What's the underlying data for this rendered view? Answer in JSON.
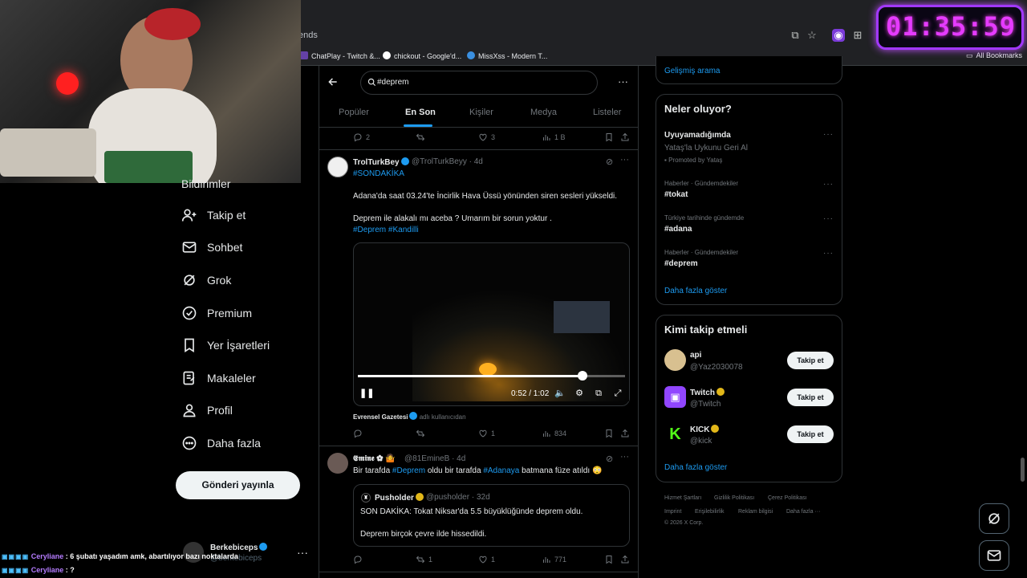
{
  "timer": "01:35:59",
  "browser": {
    "url_fragment": "ends",
    "bookmarks": [
      "ChatPlay - Twitch &...",
      "chickout - Google'd...",
      "MissXss - Modern T..."
    ],
    "all_bookmarks": "All Bookmarks"
  },
  "nav": {
    "items": [
      "Bildirimler",
      "Takip et",
      "Sohbet",
      "Grok",
      "Premium",
      "Yer İşaretleri",
      "Makaleler",
      "Profil",
      "Daha fazla"
    ],
    "post_button": "Gönderi yayınla",
    "profile_name": "Berkebiceps",
    "profile_handle": "@berkebiceps"
  },
  "chat": [
    {
      "user": "Ceryliane",
      "message": "6 şubatı yaşadım amk, abartılıyor bazı noktalarda"
    },
    {
      "user": "Ceryliane",
      "message": "?"
    }
  ],
  "search": {
    "query": "#deprem"
  },
  "tabs": [
    "Popüler",
    "En Son",
    "Kişiler",
    "Medya",
    "Listeler"
  ],
  "tweet0_actions": {
    "replies": "2",
    "retweets": "",
    "likes": "3",
    "views": "1 B"
  },
  "tweet1": {
    "name": "TrolTurkBey",
    "handle": "@TrolTurkBeyy · 4d",
    "hashtag_line": "#SONDAKİKA",
    "text1": "Adana'da saat 03.24'te İncirlik Hava Üssü yönünden siren sesleri yükseldi.",
    "text2": "Deprem ile alakalı mı aceba ? Umarım bir sorun yoktur .",
    "tags": "#Deprem #Kandilli",
    "video_time": "0:52 / 1:02",
    "video_progress": 0.84,
    "source_name": "Evrensel Gazetesi",
    "source_suffix": "adlı kullanıcıdan",
    "actions": {
      "replies": "",
      "retweets": "",
      "likes": "1",
      "views": "834"
    }
  },
  "tweet2": {
    "name": "𝕰𝖒𝖎𝖓𝖊 ✿ 🤷",
    "handle": "@81EmineB · 4d",
    "text_pre": "Bir tarafda ",
    "tag1": "#Deprem",
    "text_mid": " oldu bir tarafda ",
    "tag2": "#Adanaya",
    "text_post": " batmana füze atıldı 😳",
    "quote": {
      "name": "Pusholder",
      "handle": "@pusholder · 32d",
      "text1": "SON DAKİKA: Tokat Niksar'da 5.5 büyüklüğünde deprem oldu.",
      "text2": "Deprem birçok çevre ilde hissedildi."
    },
    "actions": {
      "replies": "",
      "retweets": "1",
      "likes": "1",
      "views": "771"
    }
  },
  "sidebar": {
    "advanced_search": "Gelişmiş arama",
    "whats_happening": "Neler oluyor?",
    "promo": {
      "title": "Uyuyamadığımda",
      "subtitle": "Yataş'la Uykunu Geri Al",
      "promoted": "Promoted by Yataş"
    },
    "trends": [
      {
        "category": "Haberler · Gündemdekiler",
        "name": "#tokat"
      },
      {
        "category": "Türkiye tarihinde gündemde",
        "name": "#adana"
      },
      {
        "category": "Haberler · Gündemdekiler",
        "name": "#deprem"
      }
    ],
    "show_more": "Daha fazla göster",
    "who_to_follow": "Kimi takip etmeli",
    "follow_label": "Takip et",
    "suggestions": [
      {
        "name": "api",
        "handle": "@Yaz2030078"
      },
      {
        "name": "Twitch",
        "handle": "@Twitch"
      },
      {
        "name": "KICK",
        "handle": "@kick"
      }
    ],
    "footer": [
      "Hizmet Şartları",
      "Gizlilik Politikası",
      "Çerez Politikası",
      "Imprint",
      "Erişilebilirlik",
      "Reklam bilgisi",
      "Daha fazla ···"
    ],
    "copyright": "© 2026 X Corp."
  }
}
